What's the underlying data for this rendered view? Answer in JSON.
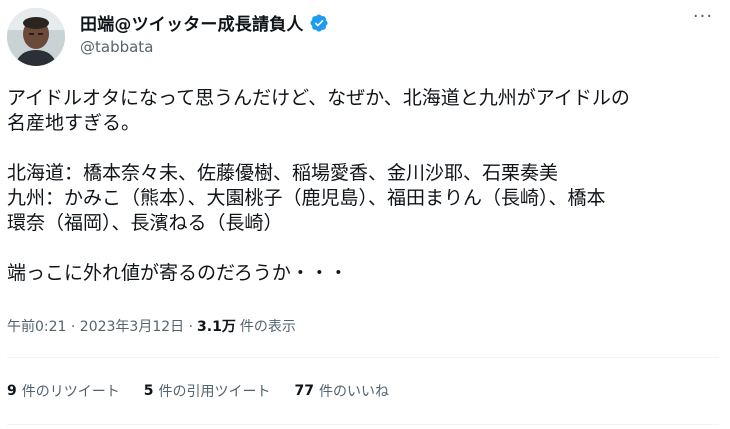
{
  "user": {
    "display_name": "田端@ツイッター成長請負人",
    "handle": "@tabbata",
    "verified_color": "#1d9bf0"
  },
  "tweet": {
    "lines": [
      "アイドルオタになって思うんだけど、なぜか、北海道と九州がアイドルの",
      "名産地すぎる。",
      "",
      "北海道：橋本奈々未、佐藤優樹、稲場愛香、金川沙耶、石栗奏美",
      "九州：かみこ（熊本）、大園桃子（鹿児島）、福田まりん（長崎）、橋本",
      "環奈（福岡）、長濱ねる（長崎）",
      "",
      "端っこに外れ値が寄るのだろうか・・・"
    ]
  },
  "meta": {
    "timestamp": "午前0:21 · 2023年3月12日 · ",
    "views": "3.1万",
    "views_label": "件の表示"
  },
  "stats": [
    {
      "num": "9",
      "label": "件のリツイート"
    },
    {
      "num": "5",
      "label": "件の引用ツイート"
    },
    {
      "num": "77",
      "label": "件のいいね"
    }
  ],
  "icons": {
    "more": "more-options-icon",
    "verified": "verified-badge-icon",
    "avatar": "user-avatar"
  }
}
